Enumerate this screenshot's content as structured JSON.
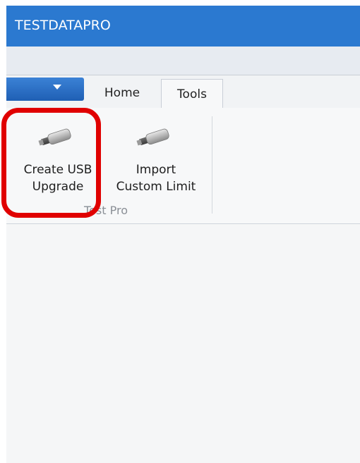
{
  "window": {
    "title": "TESTDATAPRO"
  },
  "tabs": [
    {
      "label": "Home"
    },
    {
      "label": "Tools"
    }
  ],
  "ribbon": {
    "buttons": [
      {
        "line1": "Create USB",
        "line2": "Upgrade",
        "icon": "usb-drive-icon"
      },
      {
        "line1": "Import",
        "line2": "Custom Limit",
        "icon": "usb-drive-icon"
      }
    ],
    "group_label": "Test Pro"
  },
  "colors": {
    "titlebar": "#2b79d0",
    "highlight": "#e00000"
  }
}
